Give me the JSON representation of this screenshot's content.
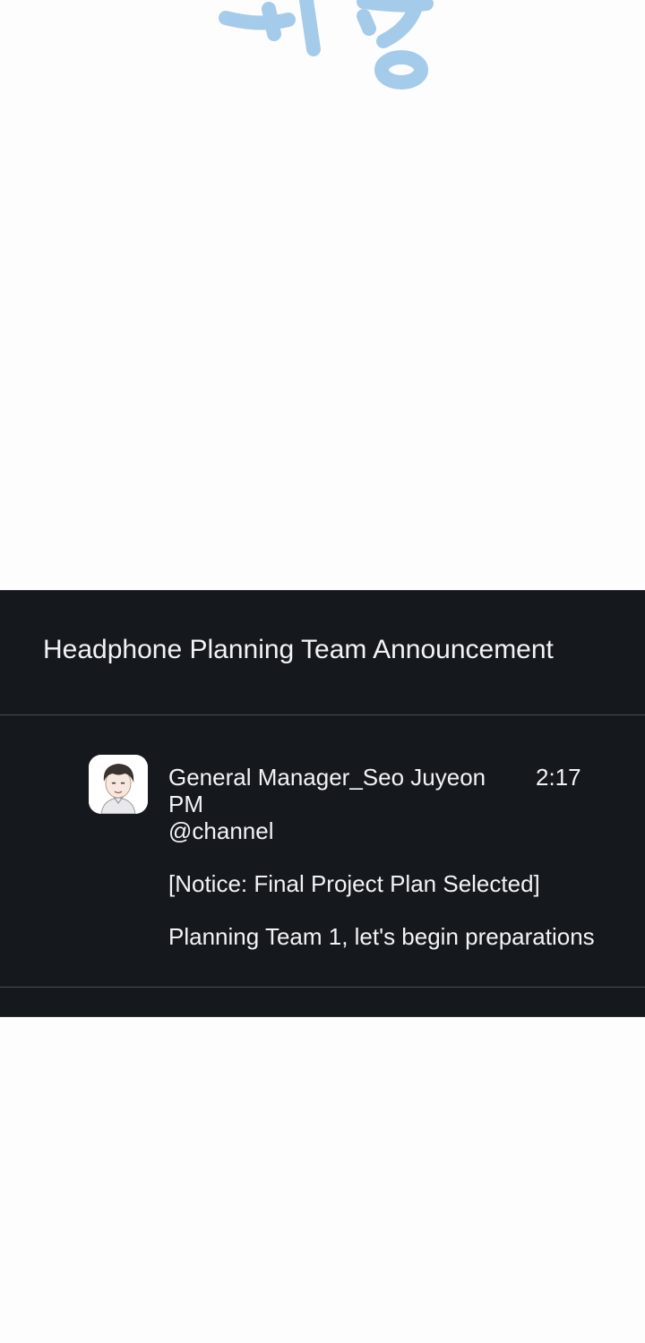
{
  "channel": {
    "title": "Headphone Planning Team Announcement"
  },
  "message": {
    "sender": "General Manager_Seo Juyeon",
    "time_hm": "2:17",
    "time_ampm": "PM",
    "mention": "@channel",
    "notice": "[Notice: Final Project Plan Selected]",
    "body": "Planning Team 1, let's begin preparations"
  },
  "colors": {
    "panel_background": "#15181d",
    "text": "#f2f3f5",
    "divider": "#4a4d53",
    "sfx_blue": "#9cc6ea"
  },
  "icons": {
    "avatar": "user-avatar-illustration"
  }
}
